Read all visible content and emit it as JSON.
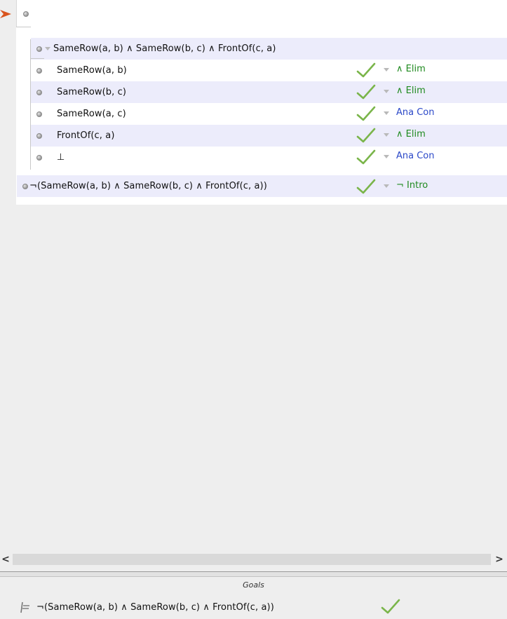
{
  "proof": {
    "premise_placeholder": "",
    "subproof": {
      "assumption": "SameRow(a, b) ∧ SameRow(b, c) ∧ FrontOf(c, a)",
      "steps": [
        {
          "sentence": "SameRow(a, b)",
          "rule": "∧ Elim",
          "rule_color": "#1f8a1f",
          "check": "valid"
        },
        {
          "sentence": "SameRow(b, c)",
          "rule": "∧ Elim",
          "rule_color": "#1f8a1f",
          "check": "valid"
        },
        {
          "sentence": "SameRow(a, c)",
          "rule": "Ana Con",
          "rule_color": "#2b48c8",
          "check": "valid"
        },
        {
          "sentence": "FrontOf(c, a)",
          "rule": "∧ Elim",
          "rule_color": "#1f8a1f",
          "check": "valid"
        },
        {
          "sentence": "⊥",
          "rule": "Ana Con",
          "rule_color": "#2b48c8",
          "check": "valid"
        }
      ]
    },
    "conclusion": {
      "sentence": "¬(SameRow(a, b) ∧ SameRow(b, c) ∧ FrontOf(c, a))",
      "rule": "¬ Intro",
      "rule_color": "#1f8a1f",
      "check": "valid"
    }
  },
  "scrollbar": {
    "left_arrow": "<",
    "right_arrow": ">"
  },
  "goals": {
    "title": "Goals",
    "items": [
      {
        "sentence": "¬(SameRow(a, b) ∧ SameRow(b, c) ∧ FrontOf(c, a))",
        "status": "satisfied"
      }
    ]
  },
  "colors": {
    "shaded_row": "#ececfb",
    "check_green": "#7ab54a",
    "focus_arrow": "#d9541e"
  }
}
